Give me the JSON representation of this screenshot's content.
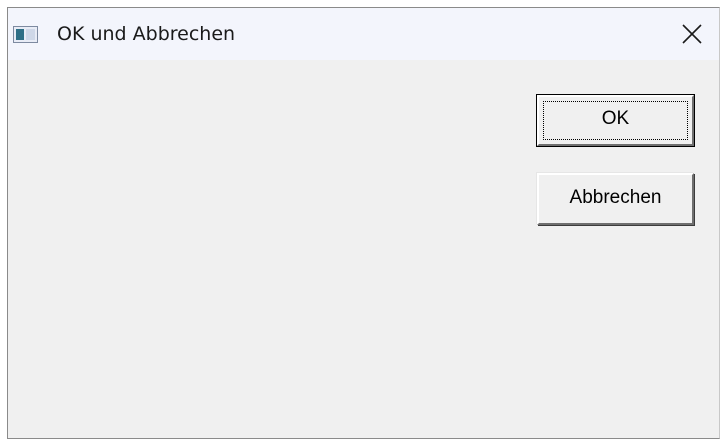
{
  "window": {
    "title": "OK und Abbrechen",
    "icon": "app-window-icon"
  },
  "titlebar": {
    "close_icon": "close-icon"
  },
  "buttons": {
    "ok_label": "OK",
    "cancel_label": "Abbrechen"
  },
  "colors": {
    "client_background": "#f0f0f0",
    "titlebar_background": "#f3f5fc"
  }
}
